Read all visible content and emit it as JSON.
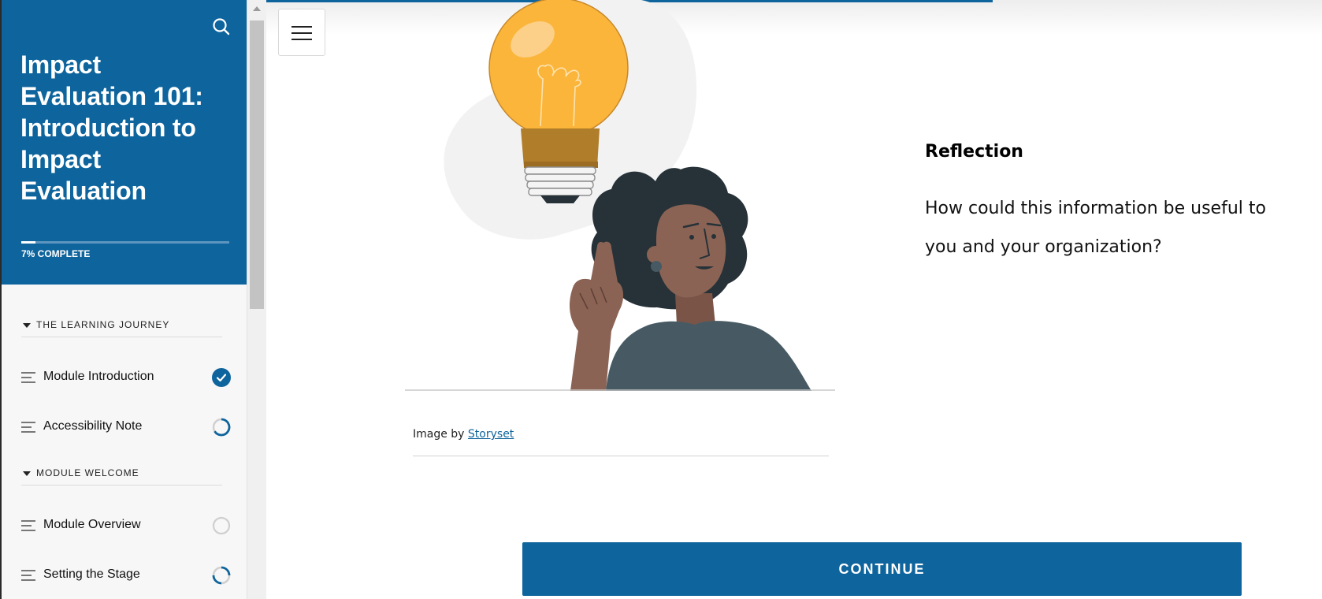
{
  "sidebar": {
    "title": "Impact Evaluation 101: Introduction to Impact Evaluation",
    "progress_percent": 7,
    "progress_label": "7% COMPLETE",
    "search_icon": "search-icon",
    "sections": [
      {
        "label": "THE LEARNING JOURNEY",
        "lessons": [
          {
            "label": "Module Introduction",
            "status": "completed"
          },
          {
            "label": "Accessibility Note",
            "status": "in-progress"
          }
        ]
      },
      {
        "label": "MODULE WELCOME",
        "lessons": [
          {
            "label": "Module Overview",
            "status": "not-started"
          },
          {
            "label": "Setting the Stage",
            "status": "in-progress"
          }
        ]
      }
    ]
  },
  "main": {
    "menu_icon": "hamburger-menu-icon",
    "image_caption_prefix": "Image by",
    "image_caption_link": "Storyset",
    "reflection_title": "Reflection",
    "reflection_body": "How could this information be useful to you and your organization?",
    "continue_label": "CONTINUE"
  },
  "colors": {
    "brand_blue": "#0e649c",
    "bulb_yellow": "#fbb53b",
    "shirt": "#475a63",
    "skin": "#8b6355",
    "hair": "#263238"
  }
}
